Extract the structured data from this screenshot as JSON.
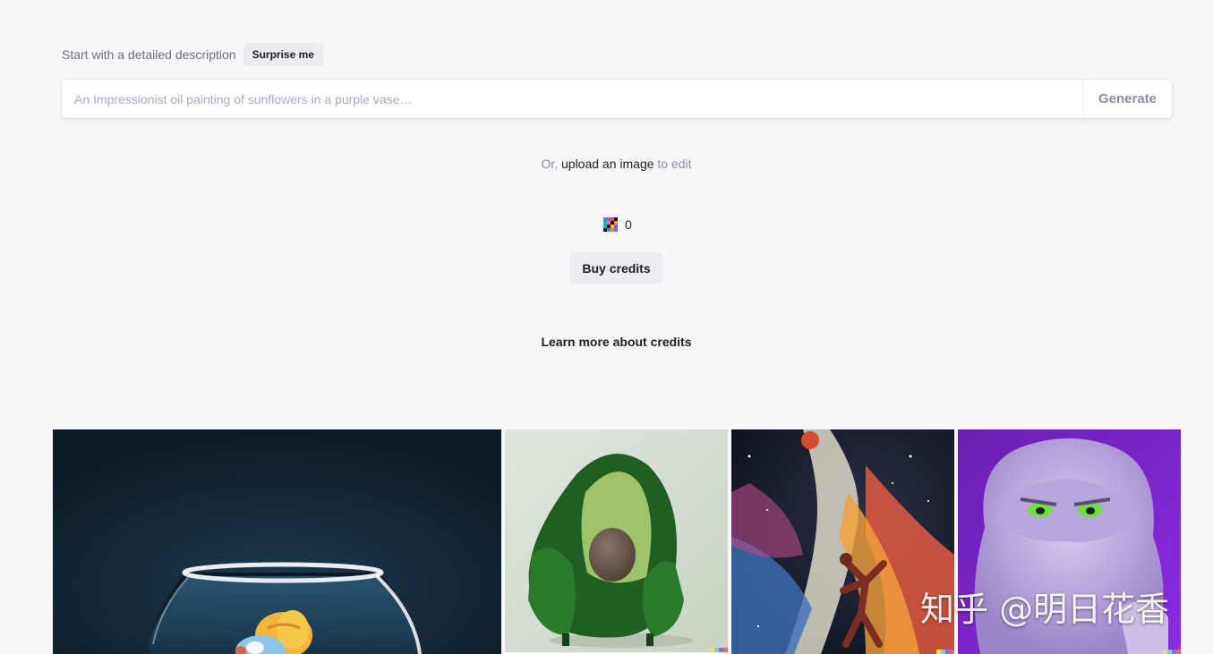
{
  "prompt": {
    "label": "Start with a detailed description",
    "surprise_label": "Surprise me"
  },
  "search": {
    "placeholder": "An Impressionist oil painting of sunflowers in a purple vase…",
    "value": "",
    "generate_label": "Generate"
  },
  "upload": {
    "prefix": "Or, ",
    "link_label": "upload an image",
    "suffix": " to edit"
  },
  "credits": {
    "icon": "credits-pixel-icon",
    "count": "0",
    "buy_label": "Buy credits",
    "learn_more_label": "Learn more about credits"
  },
  "gallery": {
    "images": [
      {
        "name": "fishbowl-image",
        "subject": "fishbowl"
      },
      {
        "name": "avocado-chair-image",
        "subject": "avocado chair"
      },
      {
        "name": "space-dancer-image",
        "subject": "space painting"
      },
      {
        "name": "purple-monster-image",
        "subject": "furry monster"
      }
    ]
  },
  "watermark": {
    "text": "知乎 @明日花香"
  },
  "colors": {
    "background": "#f8f8fa",
    "button_bg": "#ececf1",
    "muted_text": "#8e8ea0",
    "dark_text": "#202123"
  }
}
